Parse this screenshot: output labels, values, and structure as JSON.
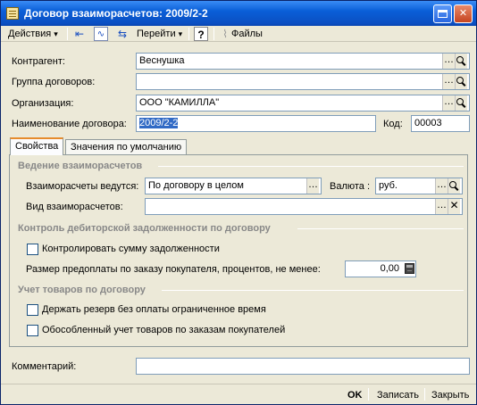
{
  "window": {
    "title": "Договор взаиморасчетов: 2009/2-2"
  },
  "toolbar": {
    "actions_label": "Действия",
    "goto_label": "Перейти",
    "help_label": "?",
    "files_label": "Файлы"
  },
  "form": {
    "counterparty_label": "Контрагент:",
    "counterparty_value": "Веснушка",
    "contract_group_label": "Группа договоров:",
    "contract_group_value": "",
    "organization_label": "Организация:",
    "organization_value": "ООО \"КАМИЛЛА\"",
    "contract_name_label": "Наименование договора:",
    "contract_name_value": "2009/2-2",
    "code_label": "Код:",
    "code_value": "00003",
    "comment_label": "Комментарий:",
    "comment_value": ""
  },
  "tabs": [
    {
      "label": "Свойства",
      "active": true
    },
    {
      "label": "Значения по умолчанию",
      "active": false
    }
  ],
  "properties": {
    "settlements_section": "Ведение взаиморасчетов",
    "settlements_mode_label": "Взаиморасчеты ведутся:",
    "settlements_mode_value": "По договору в целом",
    "currency_label": "Валюта :",
    "currency_value": "руб.",
    "settlement_type_label": "Вид взаиморасчетов:",
    "settlement_type_value": "",
    "receivables_section": "Контроль дебиторской задолженности по договору",
    "control_debt_label": "Контролировать сумму задолженности",
    "control_debt_checked": false,
    "prepayment_label": "Размер предоплаты по заказу покупателя, процентов, не менее:",
    "prepayment_value": "0,00",
    "goods_section": "Учет товаров по договору",
    "reserve_label": "Держать резерв без оплаты ограниченное время",
    "reserve_checked": false,
    "separate_accounting_label": "Обособленный учет товаров по заказам покупателей",
    "separate_accounting_checked": false
  },
  "footer": {
    "ok_label": "OK",
    "save_label": "Записать",
    "close_label": "Закрыть"
  }
}
